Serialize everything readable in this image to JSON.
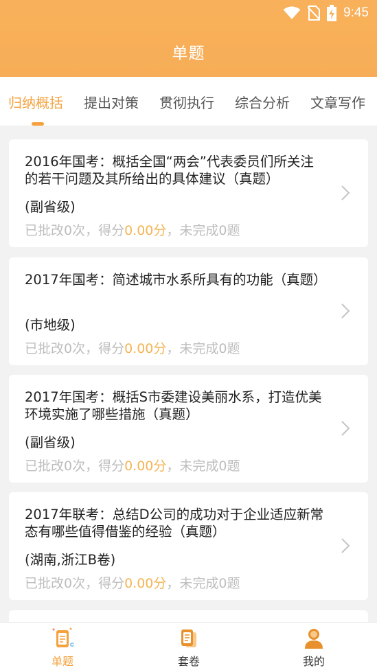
{
  "status_bar": {
    "time": "9:45"
  },
  "header": {
    "title": "单题"
  },
  "tabs": [
    {
      "label": "归纳概括",
      "active": true
    },
    {
      "label": "提出对策",
      "active": false
    },
    {
      "label": "贯彻执行",
      "active": false
    },
    {
      "label": "综合分析",
      "active": false
    },
    {
      "label": "文章写作",
      "active": false
    }
  ],
  "questions": [
    {
      "title": "2016年国考：概括全国“两会”代表委员们所关注的若干问题及其所给出的具体建议（真题）",
      "level": "(副省级)",
      "stats_prefix": "已批改0次，得分",
      "score": "0.00分",
      "stats_suffix": "，未完成0题"
    },
    {
      "title": "2017年国考：简述城市水系所具有的功能（真题）",
      "level": "(市地级)",
      "stats_prefix": "已批改0次，得分",
      "score": "0.00分",
      "stats_suffix": "，未完成0题"
    },
    {
      "title": "2017年国考：概括S市委建设美丽水系，打造优美环境实施了哪些措施（真题）",
      "level": "(副省级)",
      "stats_prefix": "已批改0次，得分",
      "score": "0.00分",
      "stats_suffix": "，未完成0题"
    },
    {
      "title": "2017年联考：总结D公司的成功对于企业适应新常态有哪些值得借鉴的经验（真题）",
      "level": "(湖南,浙江B卷)",
      "stats_prefix": "已批改0次，得分",
      "score": "0.00分",
      "stats_suffix": "，未完成0题"
    }
  ],
  "bottom_nav": [
    {
      "label": "单题",
      "icon": "single-question-icon",
      "active": true
    },
    {
      "label": "套卷",
      "icon": "paper-set-icon",
      "active": false
    },
    {
      "label": "我的",
      "icon": "profile-icon",
      "active": false
    }
  ],
  "colors": {
    "accent": "#f5a23e",
    "header": "#f8b15a",
    "muted_text": "#bdbdbd",
    "score": "#f5b453"
  }
}
